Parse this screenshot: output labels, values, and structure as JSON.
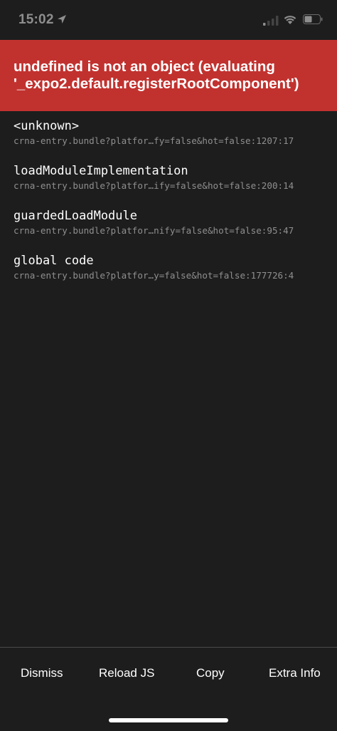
{
  "status_bar": {
    "time": "15:02",
    "icons": [
      "location-arrow-icon",
      "cellular-signal-icon",
      "wifi-icon",
      "battery-icon"
    ]
  },
  "error": {
    "message": "undefined is not an object (evaluating '_expo2.default.registerRootComponent')",
    "color": "#c1322f"
  },
  "stack": [
    {
      "method": "<unknown>",
      "file": "crna-entry.bundle?platfor…fy=false&hot=false:1207:17"
    },
    {
      "method": "loadModuleImplementation",
      "file": "crna-entry.bundle?platfor…ify=false&hot=false:200:14"
    },
    {
      "method": "guardedLoadModule",
      "file": "crna-entry.bundle?platfor…nify=false&hot=false:95:47"
    },
    {
      "method": "global code",
      "file": "crna-entry.bundle?platfor…y=false&hot=false:177726:4"
    }
  ],
  "toolbar": {
    "dismiss": "Dismiss",
    "reload": "Reload JS",
    "copy": "Copy",
    "extra_info": "Extra Info"
  }
}
